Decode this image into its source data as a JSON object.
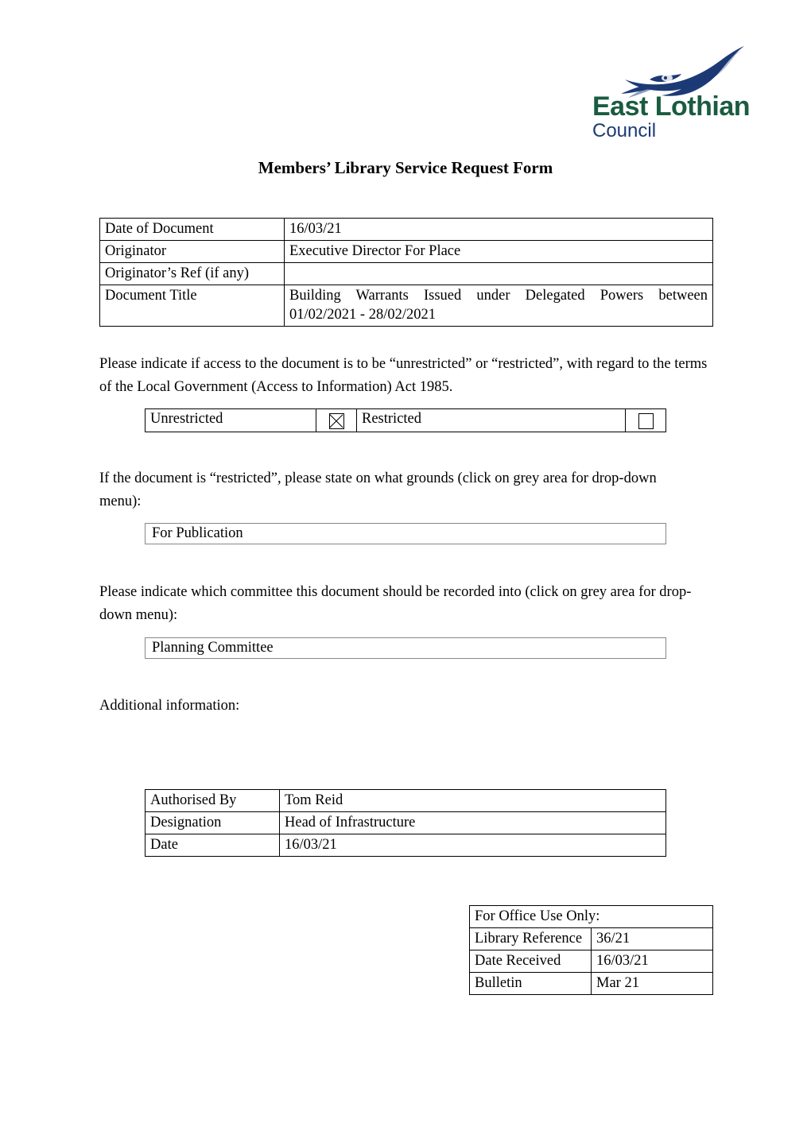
{
  "logo": {
    "bird_icon": "soaring-eagle-icon",
    "line1": "East Lothian",
    "line2": "Council",
    "green": "#1a5c41",
    "navy": "#1c3a75"
  },
  "title": "Members’ Library Service Request Form",
  "meta_table": {
    "rows": [
      {
        "label": "Date of Document",
        "value": "16/03/21"
      },
      {
        "label": "Originator",
        "value": "Executive Director For Place"
      },
      {
        "label": "Originator’s Ref (if any)",
        "value": ""
      },
      {
        "label": "Document Title",
        "value": "Building Warrants Issued under Delegated Powers between 01/02/2021 - 28/02/2021"
      }
    ]
  },
  "access_section": {
    "paragraph": "Please indicate if access to the document is to be “unrestricted” or “restricted”, with regard to the terms of the Local Government (Access to Information) Act 1985.",
    "unrestricted_label": "Unrestricted",
    "unrestricted_checked": "checked",
    "restricted_label": "Restricted",
    "restricted_checked": "unchecked"
  },
  "grounds_section": {
    "paragraph": "If the document is “restricted”, please state on what grounds (click on grey area for drop-down menu):",
    "value": "For Publication"
  },
  "committee_section": {
    "paragraph": "Please indicate which committee this document should be recorded into (click on grey area for drop-down menu):",
    "value": "Planning Committee"
  },
  "additional_info": {
    "label": "Additional information:",
    "value": ""
  },
  "authorisation_table": {
    "rows": [
      {
        "label": "Authorised By",
        "value": "Tom Reid"
      },
      {
        "label": "Designation",
        "value": "Head of Infrastructure"
      },
      {
        "label": "Date",
        "value": "16/03/21"
      }
    ]
  },
  "office_table": {
    "heading": "For Office Use Only:",
    "rows": [
      {
        "label": "Library Reference",
        "value": "36/21"
      },
      {
        "label": "Date Received",
        "value": "16/03/21"
      },
      {
        "label": "Bulletin",
        "value": "Mar 21"
      }
    ]
  }
}
